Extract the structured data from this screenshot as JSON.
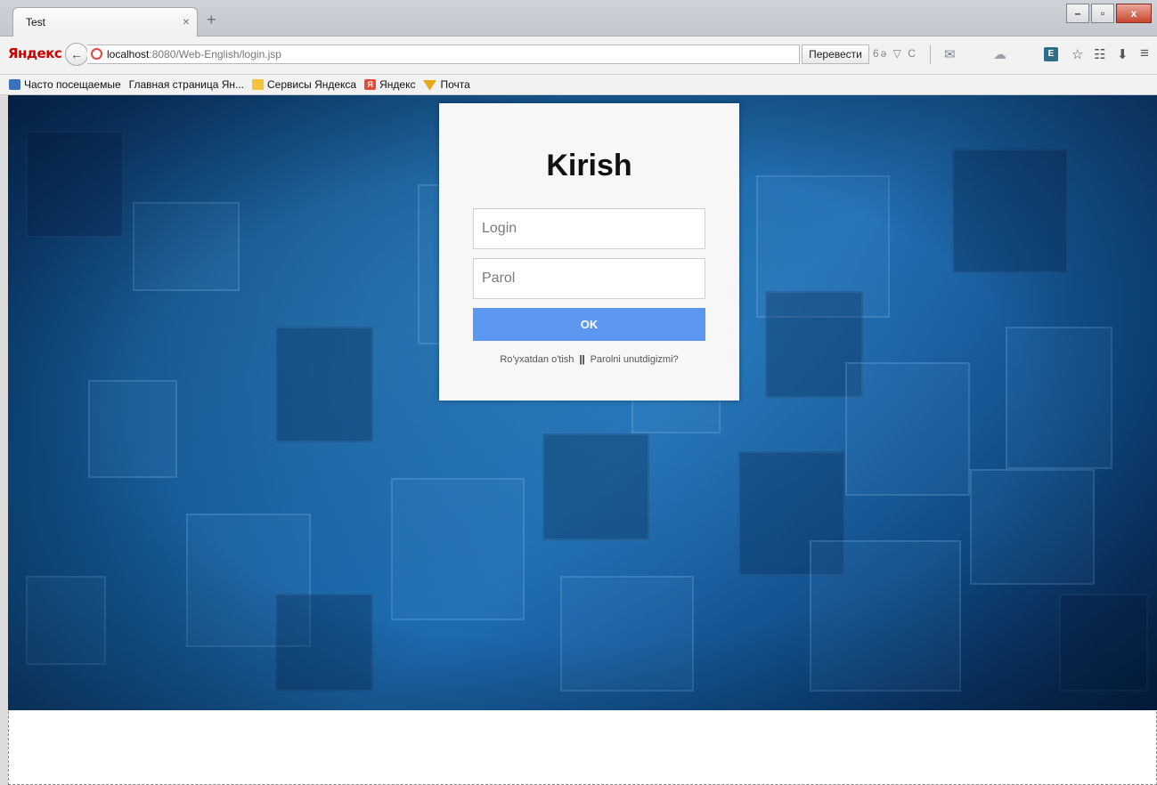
{
  "browser": {
    "tab": {
      "title": "Test",
      "close": "×"
    },
    "new_tab": "+",
    "window": {
      "minimize": "–",
      "restore": "▫",
      "close": "x"
    },
    "nav": {
      "logo": "Яндекс",
      "url_host": "localhost",
      "url_path": ":8080/Web-English/login.jsp",
      "translate": "Перевести",
      "url_extras": "6ə ▽ C"
    },
    "bookmarks": [
      {
        "label": "Часто посещаемые"
      },
      {
        "label": "Главная страница Ян..."
      },
      {
        "label": "Сервисы Яндекса"
      },
      {
        "label": "Яндекс"
      },
      {
        "label": "Почта"
      }
    ]
  },
  "login": {
    "title": "Kirish",
    "login_placeholder": "Login",
    "password_placeholder": "Parol",
    "ok_label": "OK",
    "register_link": "Ro'yxatdan o'tish",
    "separator": "||",
    "forgot_link": "Parolni unutdigizmi?"
  },
  "colors": {
    "ok_button": "#5b96f0",
    "background": "#145c99",
    "card": "#f7f7f7"
  }
}
